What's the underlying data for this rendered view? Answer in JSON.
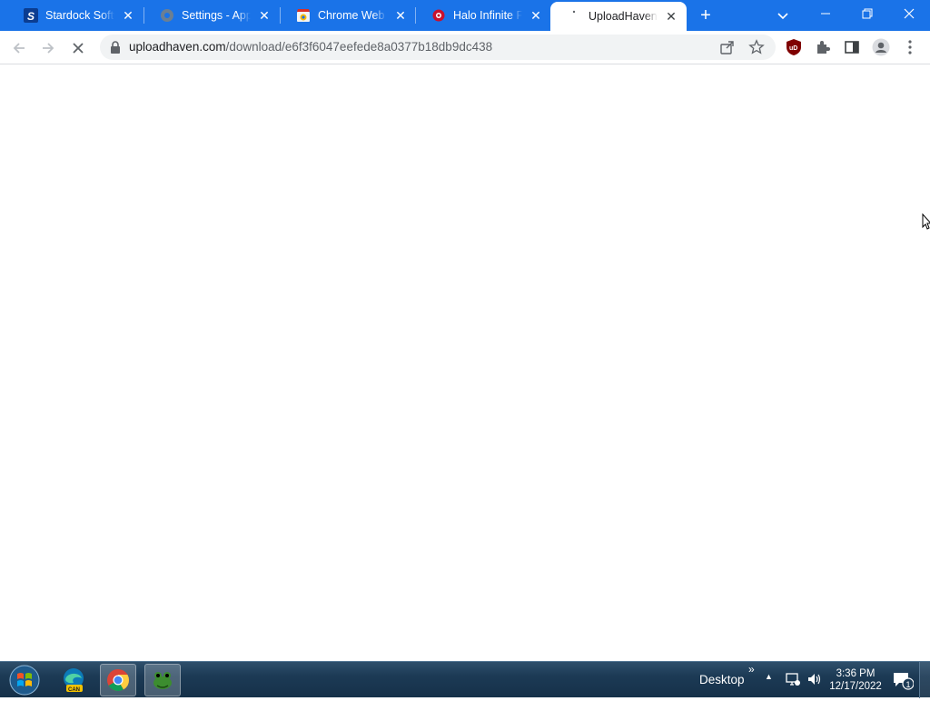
{
  "browser": {
    "tabs": [
      {
        "title": "Stardock Software",
        "favicon": "stardock-icon",
        "active": false
      },
      {
        "title": "Settings - Appearance",
        "favicon": "settings-gear-icon",
        "active": false
      },
      {
        "title": "Chrome Web Store",
        "favicon": "chrome-web-store-icon",
        "active": false
      },
      {
        "title": "Halo Infinite Free",
        "favicon": "halo-icon",
        "active": false
      },
      {
        "title": "UploadHaven - ",
        "favicon": "loading-spinner-icon",
        "active": true
      }
    ],
    "tab_close_glyph": "✕",
    "new_tab_glyph": "+",
    "window_controls": [
      "minimize-icon",
      "restore-icon",
      "close-icon"
    ],
    "accent": "#1a73e8"
  },
  "toolbar": {
    "url_host": "uploadhaven.com",
    "url_path": "/download/e6f3f6047eefede8a0377b18db9dc438",
    "icons": [
      "back-arrow-icon",
      "forward-arrow-icon",
      "stop-loading-icon",
      "lock-icon",
      "share-icon",
      "bookmark-star-icon",
      "ublock-origin-icon",
      "extensions-puzzle-icon",
      "side-panel-icon",
      "profile-avatar-icon",
      "menu-kebab-icon"
    ],
    "ublock_label": "uD"
  },
  "taskbar": {
    "desktop_label": "Desktop",
    "expand_glyph": "»",
    "tray_arrow": "▲",
    "time": "3:36 PM",
    "date": "12/17/2022",
    "notification_count": "1",
    "edge_badge": "CAN",
    "apps": [
      "edge-canary-icon",
      "chrome-icon",
      "frog-app-icon"
    ]
  }
}
